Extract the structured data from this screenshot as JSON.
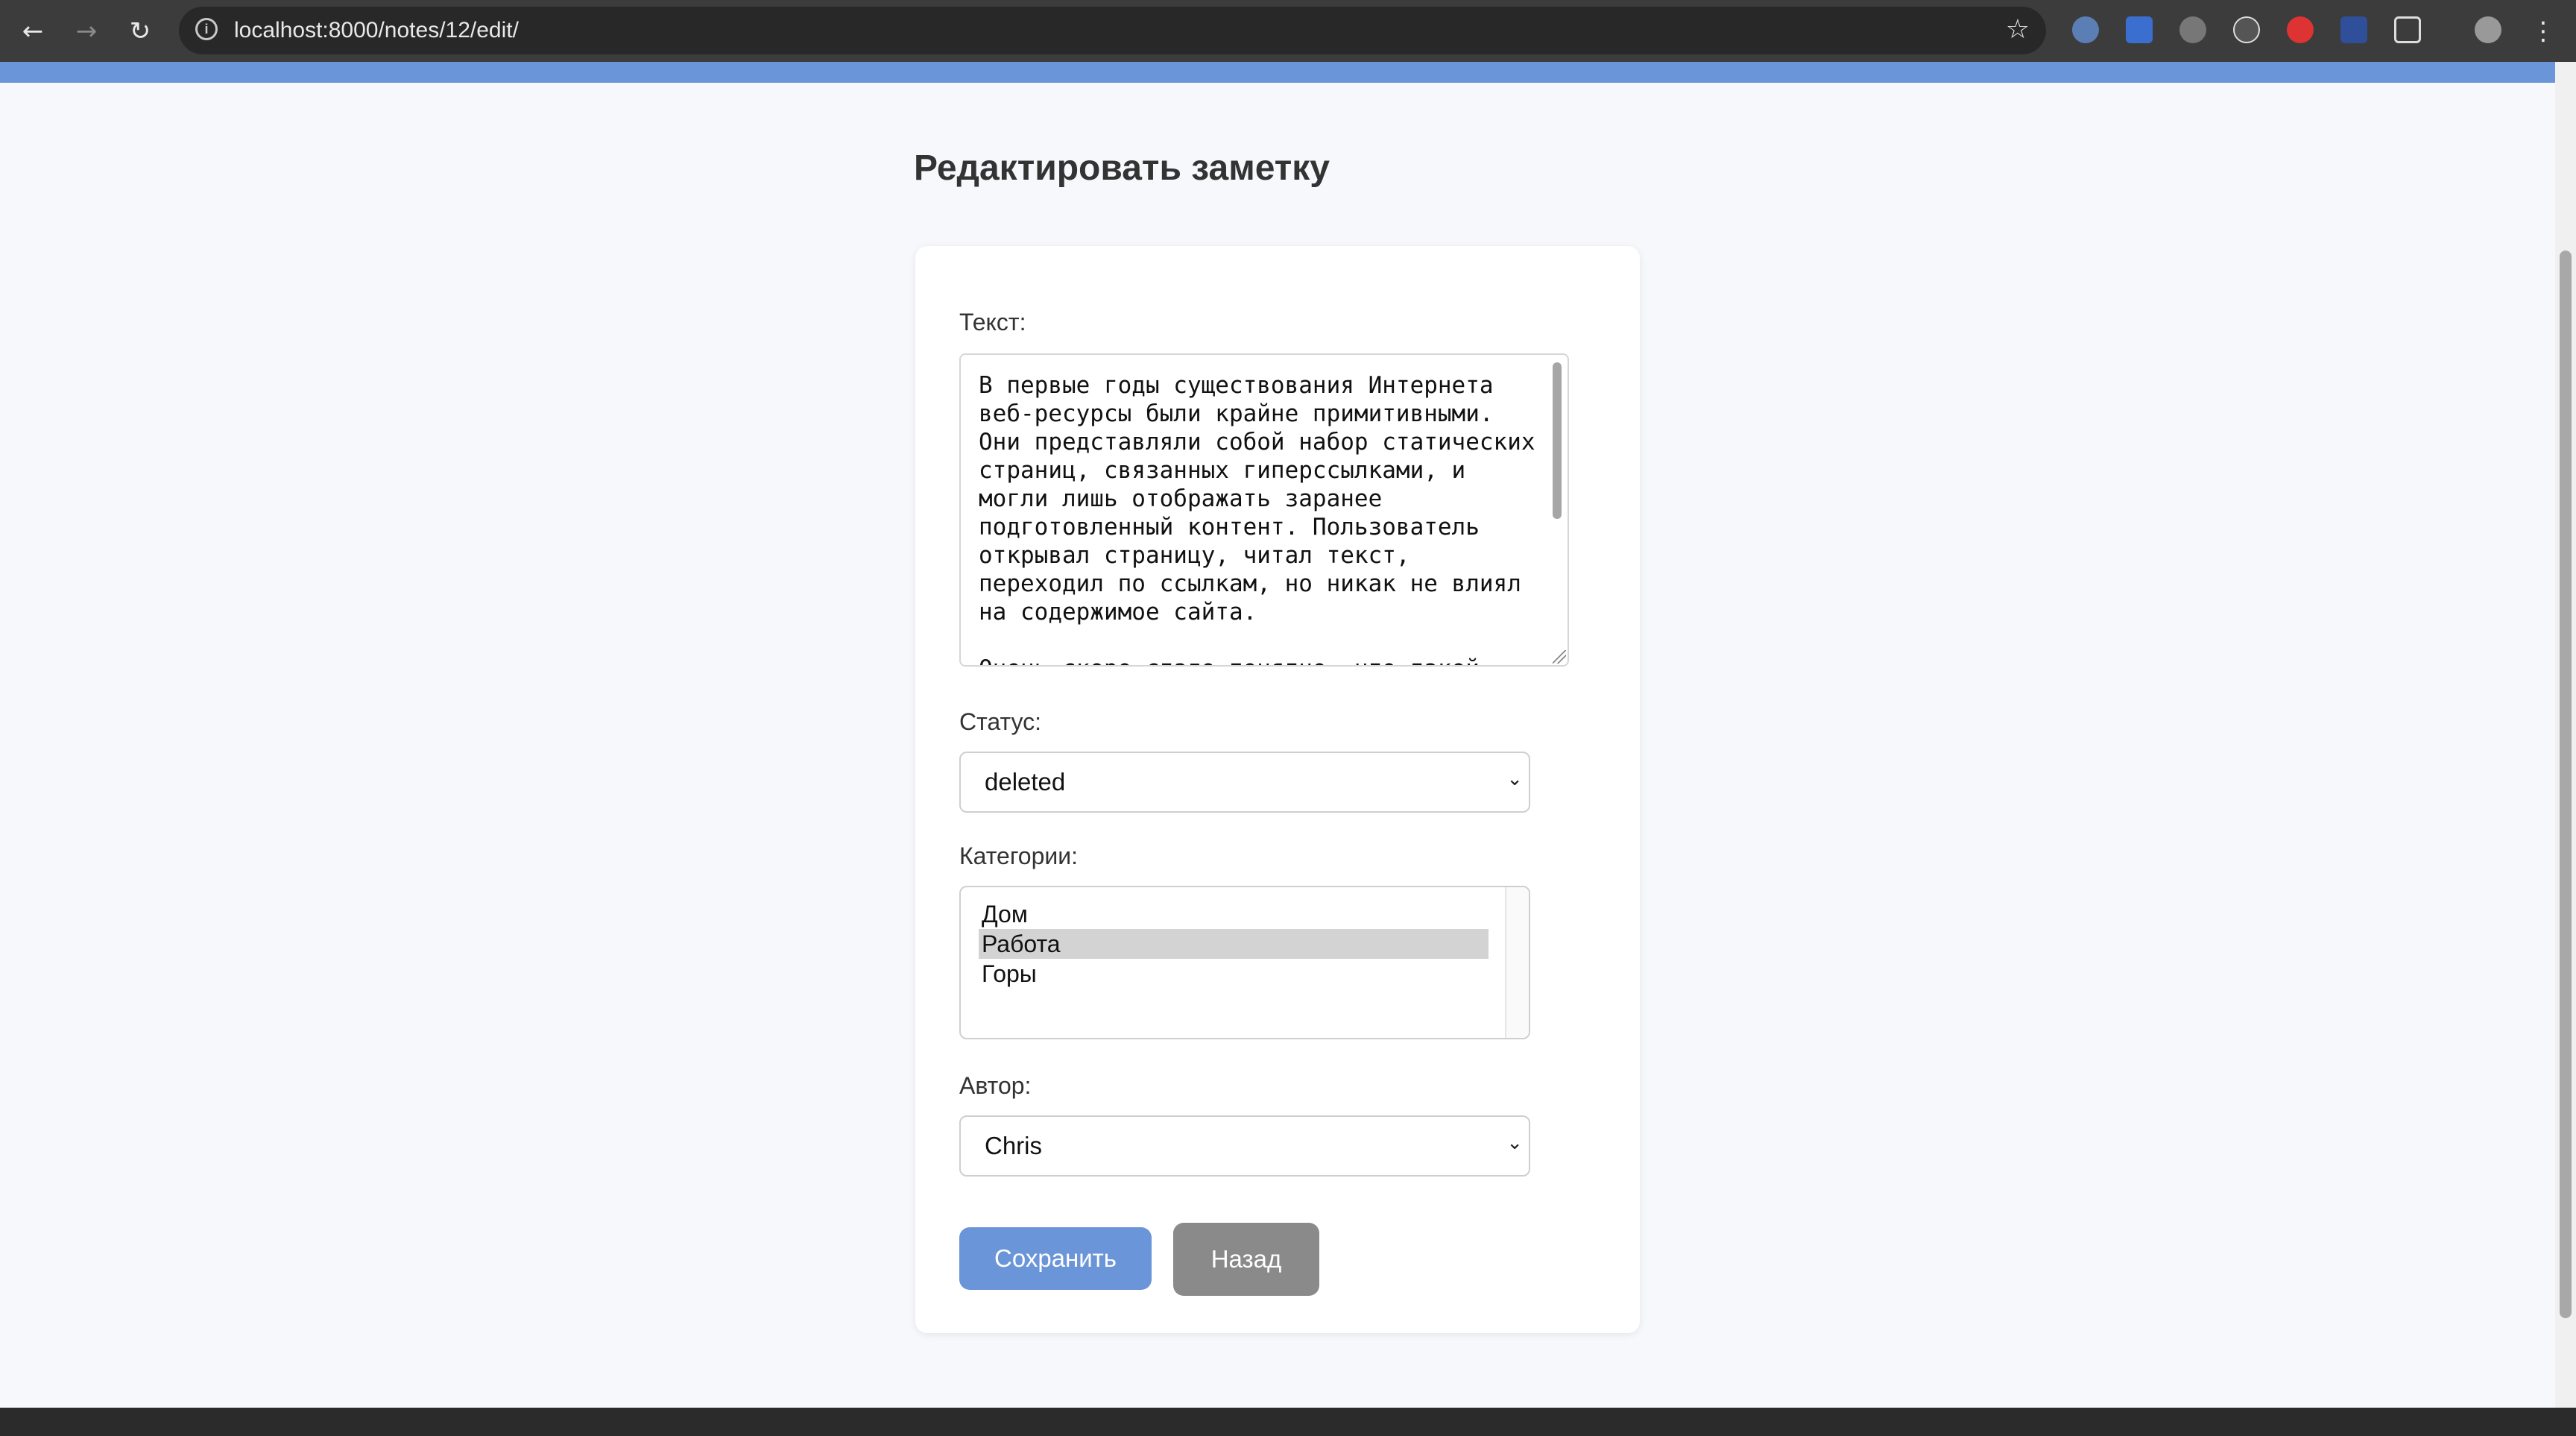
{
  "browser": {
    "url": "localhost:8000/notes/12/edit/",
    "back_icon": "←",
    "forward_icon": "→",
    "reload_icon": "↻",
    "info_icon": "i",
    "star_icon": "☆",
    "menu_icon": "⋮"
  },
  "page": {
    "title": "Редактировать заметку"
  },
  "form": {
    "text_label": "Текст:",
    "text_value": "В первые годы существования Интернета веб-ресурсы были крайне примитивными. Они представляли собой набор статических страниц, связанных гиперссылками, и могли лишь отображать заранее подготовленный контент. Пользователь открывал страницу, читал текст, переходил по ссылкам, но никак не влиял на содержимое сайта.\n\nОчень скоро стало понятно, что такой",
    "status_label": "Статус:",
    "status_value": "deleted",
    "categories_label": "Категории:",
    "categories": [
      {
        "label": "Дом",
        "selected": false
      },
      {
        "label": "Работа",
        "selected": true
      },
      {
        "label": "Горы",
        "selected": false
      }
    ],
    "author_label": "Автор:",
    "author_value": "Chris",
    "save_label": "Сохранить",
    "back_label": "Назад"
  },
  "colors": {
    "accent": "#6a95d8",
    "back_button": "#8a8a8a",
    "page_bg": "#f7f8fc"
  }
}
